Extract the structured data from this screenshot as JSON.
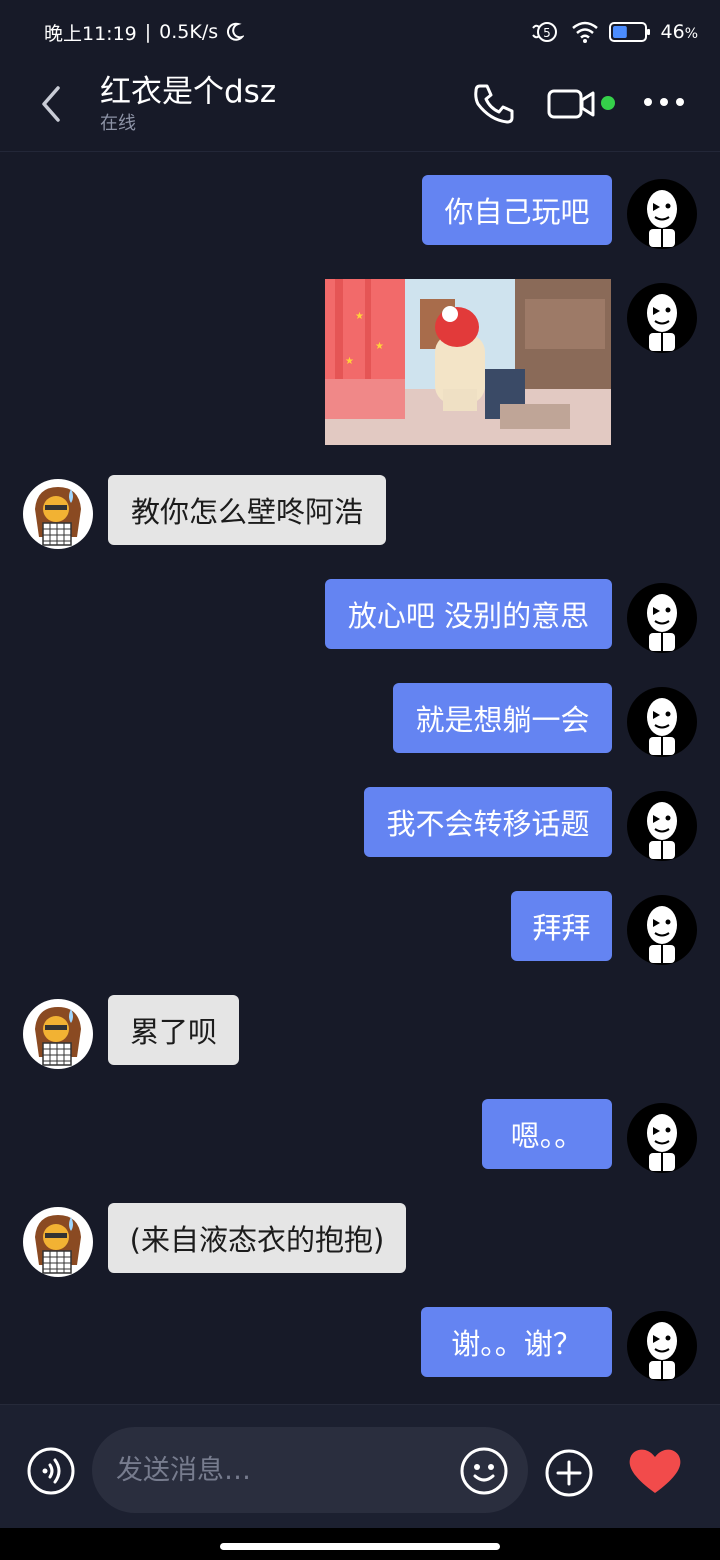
{
  "status_bar": {
    "time": "晚上11:19",
    "separator": "|",
    "net_speed": "0.5K/s",
    "battery_percent": "46",
    "battery_unit": "%",
    "battery_level": 0.46
  },
  "header": {
    "title": "红衣是个dsz",
    "subtitle": "在线"
  },
  "messages": [
    {
      "side": "out",
      "type": "text",
      "text": "你自己玩吧"
    },
    {
      "side": "out",
      "type": "image"
    },
    {
      "side": "in",
      "type": "text",
      "text": "教你怎么壁咚阿浩"
    },
    {
      "side": "out",
      "type": "text",
      "text": "放心吧 没别的意思"
    },
    {
      "side": "out",
      "type": "text",
      "text": "就是想躺一会"
    },
    {
      "side": "out",
      "type": "text",
      "text": "我不会转移话题"
    },
    {
      "side": "out",
      "type": "text",
      "text": "拜拜"
    },
    {
      "side": "in",
      "type": "text",
      "text": "累了呗"
    },
    {
      "side": "out",
      "type": "text",
      "text": "嗯。。"
    },
    {
      "side": "in",
      "type": "text",
      "text": "(来自液态衣的抱抱)"
    },
    {
      "side": "out",
      "type": "text",
      "text": "谢。。谢？"
    }
  ],
  "input": {
    "placeholder": "发送消息…",
    "value": ""
  },
  "icons": {
    "back": "chevron-left-icon",
    "phone": "phone-icon",
    "video": "video-camera-icon",
    "more": "more-icon",
    "voice": "voice-icon",
    "emoji": "emoji-icon",
    "plus": "plus-icon",
    "like": "heart-icon"
  },
  "colors": {
    "background": "#171a28",
    "outgoing_bubble": "#6484f2",
    "incoming_bubble": "#e5e5e5",
    "online": "#35d04a",
    "heart": "#f24b4b"
  }
}
